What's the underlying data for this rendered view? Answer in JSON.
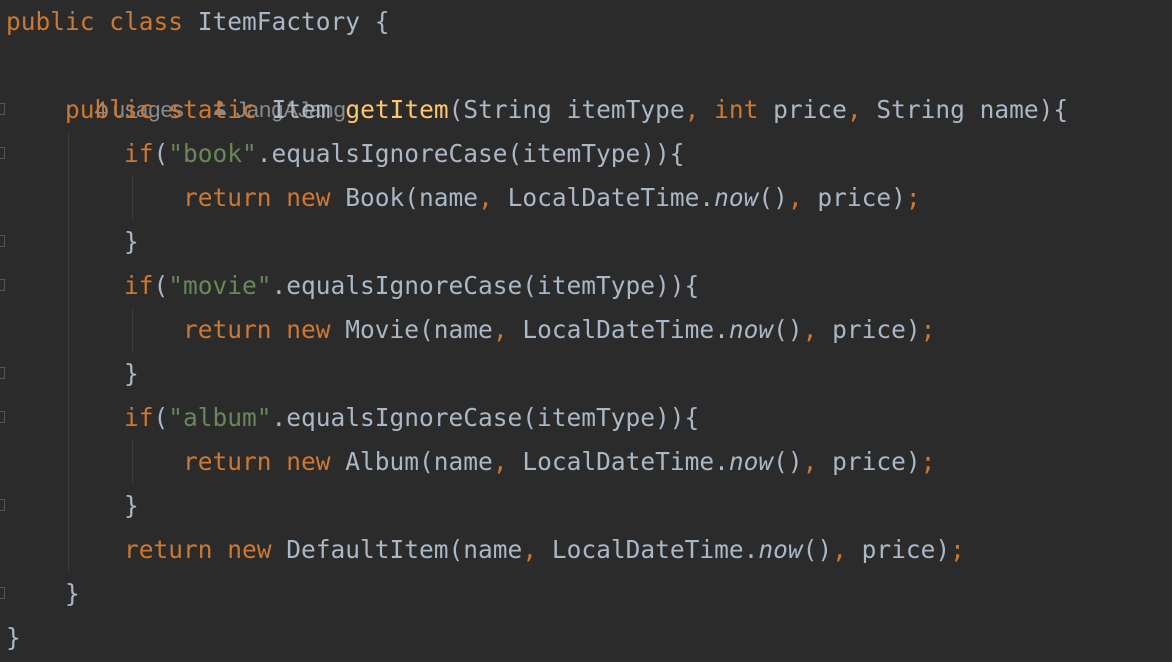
{
  "editor": {
    "lines": [
      [
        {
          "t": "public",
          "c": "kw"
        },
        {
          "t": " ",
          "c": "plain"
        },
        {
          "t": "class",
          "c": "kw"
        },
        {
          "t": " ItemFactory {",
          "c": "plain"
        }
      ],
      [],
      [
        {
          "t": "    public",
          "c": "kw"
        },
        {
          "t": " ",
          "c": "plain"
        },
        {
          "t": "static",
          "c": "kw"
        },
        {
          "t": " Item ",
          "c": "plain"
        },
        {
          "t": "getItem",
          "c": "fn"
        },
        {
          "t": "(String itemType",
          "c": "plain"
        },
        {
          "t": ",",
          "c": "kw"
        },
        {
          "t": " ",
          "c": "plain"
        },
        {
          "t": "int",
          "c": "kw"
        },
        {
          "t": " price",
          "c": "plain"
        },
        {
          "t": ",",
          "c": "kw"
        },
        {
          "t": " String name){",
          "c": "plain"
        }
      ],
      [
        {
          "t": "        if",
          "c": "kw"
        },
        {
          "t": "(",
          "c": "plain"
        },
        {
          "t": "\"book\"",
          "c": "str"
        },
        {
          "t": ".equalsIgnoreCase(itemType)){",
          "c": "plain"
        }
      ],
      [
        {
          "t": "            return",
          "c": "kw"
        },
        {
          "t": " ",
          "c": "plain"
        },
        {
          "t": "new",
          "c": "kw"
        },
        {
          "t": " Book(name",
          "c": "plain"
        },
        {
          "t": ",",
          "c": "kw"
        },
        {
          "t": " LocalDateTime.",
          "c": "plain"
        },
        {
          "t": "now",
          "c": "it"
        },
        {
          "t": "()",
          "c": "plain"
        },
        {
          "t": ",",
          "c": "kw"
        },
        {
          "t": " price)",
          "c": "plain"
        },
        {
          "t": ";",
          "c": "kw"
        }
      ],
      [
        {
          "t": "        }",
          "c": "plain"
        }
      ],
      [
        {
          "t": "        if",
          "c": "kw"
        },
        {
          "t": "(",
          "c": "plain"
        },
        {
          "t": "\"movie\"",
          "c": "str"
        },
        {
          "t": ".equalsIgnoreCase(itemType)){",
          "c": "plain"
        }
      ],
      [
        {
          "t": "            return",
          "c": "kw"
        },
        {
          "t": " ",
          "c": "plain"
        },
        {
          "t": "new",
          "c": "kw"
        },
        {
          "t": " Movie(name",
          "c": "plain"
        },
        {
          "t": ",",
          "c": "kw"
        },
        {
          "t": " LocalDateTime.",
          "c": "plain"
        },
        {
          "t": "now",
          "c": "it"
        },
        {
          "t": "()",
          "c": "plain"
        },
        {
          "t": ",",
          "c": "kw"
        },
        {
          "t": " price)",
          "c": "plain"
        },
        {
          "t": ";",
          "c": "kw"
        }
      ],
      [
        {
          "t": "        }",
          "c": "plain"
        }
      ],
      [
        {
          "t": "        if",
          "c": "kw"
        },
        {
          "t": "(",
          "c": "plain"
        },
        {
          "t": "\"album\"",
          "c": "str"
        },
        {
          "t": ".equalsIgnoreCase(itemType)){",
          "c": "plain"
        }
      ],
      [
        {
          "t": "            return",
          "c": "kw"
        },
        {
          "t": " ",
          "c": "plain"
        },
        {
          "t": "new",
          "c": "kw"
        },
        {
          "t": " Album(name",
          "c": "plain"
        },
        {
          "t": ",",
          "c": "kw"
        },
        {
          "t": " LocalDateTime.",
          "c": "plain"
        },
        {
          "t": "now",
          "c": "it"
        },
        {
          "t": "()",
          "c": "plain"
        },
        {
          "t": ",",
          "c": "kw"
        },
        {
          "t": " price)",
          "c": "plain"
        },
        {
          "t": ";",
          "c": "kw"
        }
      ],
      [
        {
          "t": "        }",
          "c": "plain"
        }
      ],
      [
        {
          "t": "        return",
          "c": "kw"
        },
        {
          "t": " ",
          "c": "plain"
        },
        {
          "t": "new",
          "c": "kw"
        },
        {
          "t": " DefaultItem(name",
          "c": "plain"
        },
        {
          "t": ",",
          "c": "kw"
        },
        {
          "t": " LocalDateTime.",
          "c": "plain"
        },
        {
          "t": "now",
          "c": "it"
        },
        {
          "t": "()",
          "c": "plain"
        },
        {
          "t": ",",
          "c": "kw"
        },
        {
          "t": " price)",
          "c": "plain"
        },
        {
          "t": ";",
          "c": "kw"
        }
      ],
      [
        {
          "t": "    }",
          "c": "plain"
        }
      ],
      [
        {
          "t": "}",
          "c": "plain"
        }
      ]
    ],
    "inlay_hint": {
      "usages": "4 usages",
      "author": "JangAJang",
      "author_icon": "person-icon"
    },
    "colors": {
      "background": "#2b2b2b",
      "keyword": "#cc7832",
      "function": "#ffc66d",
      "string": "#6a8759",
      "text": "#a9b7c6",
      "hint": "#8a8a8a"
    }
  }
}
